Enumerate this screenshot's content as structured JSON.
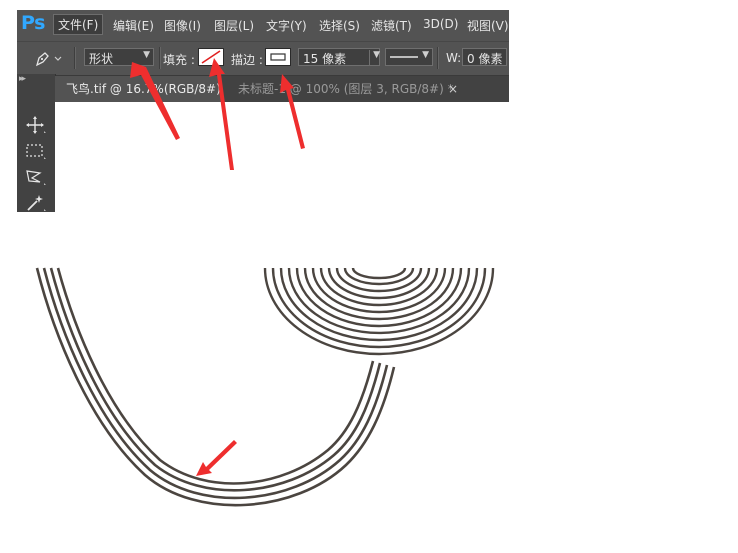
{
  "app": {
    "logo": "Ps"
  },
  "menubar": {
    "items": [
      "文件(F)",
      "编辑(E)",
      "图像(I)",
      "图层(L)",
      "文字(Y)",
      "选择(S)",
      "滤镜(T)",
      "3D(D)",
      "视图(V)"
    ],
    "active_index": 0
  },
  "options_bar": {
    "tool_icon": "pen-icon",
    "mode_value": "形状",
    "fill_label": "填充 :",
    "fill_swatch": "none",
    "stroke_label": "描边 :",
    "stroke_swatch": "solid-stroke",
    "stroke_width_value": "15 像素",
    "stroke_style": "solid-line",
    "width_label": "W:",
    "width_value": "0 像素"
  },
  "tabs": [
    {
      "label": "飞鸟.tif @ 16.7%(RGB/8#)",
      "active": true
    },
    {
      "label": "未标题-1 @ 100% (图层 3, RGB/8#) *",
      "active": false,
      "close": "×"
    }
  ],
  "toolbox": {
    "tools": [
      "move-icon",
      "marquee-icon",
      "lasso-icon",
      "magic-wand-icon"
    ]
  },
  "colors": {
    "ui_bg": "#535353",
    "panel_bg": "#424242",
    "ps_blue": "#31a8ff",
    "artwork_stroke": "#4b4540",
    "annotation_red": "#ee2e2e"
  }
}
